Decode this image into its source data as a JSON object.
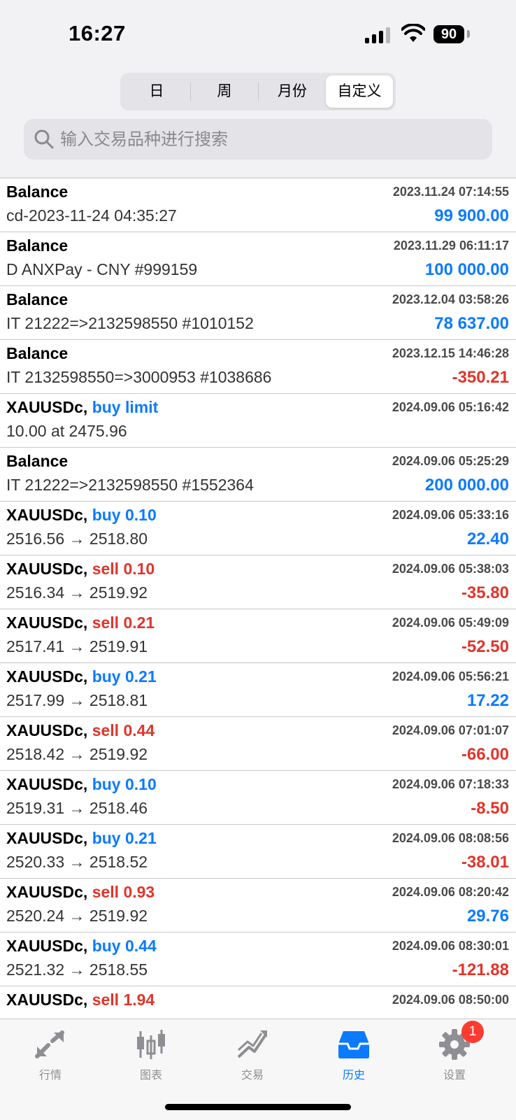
{
  "status": {
    "time": "16:27",
    "battery": "90"
  },
  "segments": [
    {
      "label": "日",
      "active": false
    },
    {
      "label": "周",
      "active": false
    },
    {
      "label": "月份",
      "active": false
    },
    {
      "label": "自定义",
      "active": true
    }
  ],
  "search": {
    "placeholder": "输入交易品种进行搜索"
  },
  "rows": [
    {
      "symbol": "Balance",
      "action": "",
      "action_color": "",
      "date": "2023.11.24 07:14:55",
      "desc": "cd-2023-11-24 04:35:27",
      "amount": "99 900.00",
      "amount_color": "blue"
    },
    {
      "symbol": "Balance",
      "action": "",
      "action_color": "",
      "date": "2023.11.29 06:11:17",
      "desc": "D ANXPay - CNY #999159",
      "amount": "100 000.00",
      "amount_color": "blue"
    },
    {
      "symbol": "Balance",
      "action": "",
      "action_color": "",
      "date": "2023.12.04 03:58:26",
      "desc": "IT 21222=>2132598550 #1010152",
      "amount": "78 637.00",
      "amount_color": "blue"
    },
    {
      "symbol": "Balance",
      "action": "",
      "action_color": "",
      "date": "2023.12.15 14:46:28",
      "desc": "IT 2132598550=>3000953 #1038686",
      "amount": "-350.21",
      "amount_color": "red"
    },
    {
      "symbol": "XAUUSDc,",
      "action": "buy limit",
      "action_color": "blue",
      "date": "2024.09.06 05:16:42",
      "desc": "10.00 at 2475.96",
      "amount": "",
      "amount_color": "blue"
    },
    {
      "symbol": "Balance",
      "action": "",
      "action_color": "",
      "date": "2024.09.06 05:25:29",
      "desc": "IT 21222=>2132598550 #1552364",
      "amount": "200 000.00",
      "amount_color": "blue"
    },
    {
      "symbol": "XAUUSDc,",
      "action": "buy 0.10",
      "action_color": "blue",
      "date": "2024.09.06 05:33:16",
      "desc": "2516.56 → 2518.80",
      "amount": "22.40",
      "amount_color": "blue"
    },
    {
      "symbol": "XAUUSDc,",
      "action": "sell 0.10",
      "action_color": "red",
      "date": "2024.09.06 05:38:03",
      "desc": "2516.34 → 2519.92",
      "amount": "-35.80",
      "amount_color": "red"
    },
    {
      "symbol": "XAUUSDc,",
      "action": "sell 0.21",
      "action_color": "red",
      "date": "2024.09.06 05:49:09",
      "desc": "2517.41 → 2519.91",
      "amount": "-52.50",
      "amount_color": "red"
    },
    {
      "symbol": "XAUUSDc,",
      "action": "buy 0.21",
      "action_color": "blue",
      "date": "2024.09.06 05:56:21",
      "desc": "2517.99 → 2518.81",
      "amount": "17.22",
      "amount_color": "blue"
    },
    {
      "symbol": "XAUUSDc,",
      "action": "sell 0.44",
      "action_color": "red",
      "date": "2024.09.06 07:01:07",
      "desc": "2518.42 → 2519.92",
      "amount": "-66.00",
      "amount_color": "red"
    },
    {
      "symbol": "XAUUSDc,",
      "action": "buy 0.10",
      "action_color": "blue",
      "date": "2024.09.06 07:18:33",
      "desc": "2519.31 → 2518.46",
      "amount": "-8.50",
      "amount_color": "red"
    },
    {
      "symbol": "XAUUSDc,",
      "action": "buy 0.21",
      "action_color": "blue",
      "date": "2024.09.06 08:08:56",
      "desc": "2520.33 → 2518.52",
      "amount": "-38.01",
      "amount_color": "red"
    },
    {
      "symbol": "XAUUSDc,",
      "action": "sell 0.93",
      "action_color": "red",
      "date": "2024.09.06 08:20:42",
      "desc": "2520.24 → 2519.92",
      "amount": "29.76",
      "amount_color": "blue"
    },
    {
      "symbol": "XAUUSDc,",
      "action": "buy 0.44",
      "action_color": "blue",
      "date": "2024.09.06 08:30:01",
      "desc": "2521.32 → 2518.55",
      "amount": "-121.88",
      "amount_color": "red"
    },
    {
      "symbol": "XAUUSDc,",
      "action": "sell 1.94",
      "action_color": "red",
      "date": "2024.09.06 08:50:00",
      "desc": "",
      "amount": "",
      "amount_color": "red"
    }
  ],
  "tabs": [
    {
      "label": "行情",
      "icon": "quotes-icon",
      "active": false
    },
    {
      "label": "图表",
      "icon": "chart-candles-icon",
      "active": false
    },
    {
      "label": "交易",
      "icon": "trade-icon",
      "active": false
    },
    {
      "label": "历史",
      "icon": "history-inbox-icon",
      "active": true
    },
    {
      "label": "设置",
      "icon": "gear-icon",
      "active": false,
      "badge": "1"
    }
  ],
  "colors": {
    "blue": "#0a7aff",
    "red": "#e1352a",
    "inactive": "#8e8e93"
  }
}
